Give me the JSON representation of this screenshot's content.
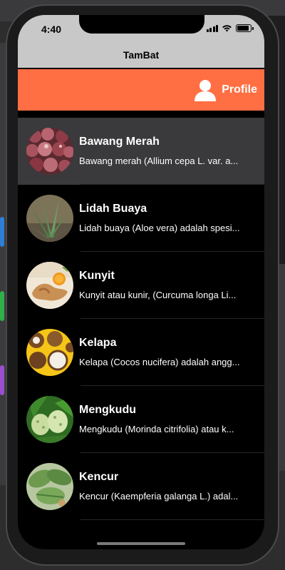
{
  "status_bar": {
    "time": "4:40"
  },
  "nav": {
    "title": "TamBat"
  },
  "header": {
    "profile_label": "Profile",
    "profile_icon": "person-icon",
    "color": "#ff6f43"
  },
  "items": [
    {
      "name": "Bawang Merah",
      "desc": "Bawang merah (Allium cepa L. var. a...",
      "icon": "shallot-image",
      "selected": true
    },
    {
      "name": "Lidah Buaya",
      "desc": "Lidah buaya (Aloe vera) adalah spesi...",
      "icon": "aloe-image",
      "selected": false
    },
    {
      "name": "Kunyit",
      "desc": "Kunyit atau kunir, (Curcuma longa Li...",
      "icon": "turmeric-image",
      "selected": false
    },
    {
      "name": "Kelapa",
      "desc": "Kelapa (Cocos nucifera) adalah angg...",
      "icon": "coconut-image",
      "selected": false
    },
    {
      "name": "Mengkudu",
      "desc": "Mengkudu (Morinda citrifolia) atau k...",
      "icon": "noni-image",
      "selected": false
    },
    {
      "name": "Kencur",
      "desc": "Kencur (Kaempferia galanga L.) adal...",
      "icon": "galangal-image",
      "selected": false
    }
  ]
}
